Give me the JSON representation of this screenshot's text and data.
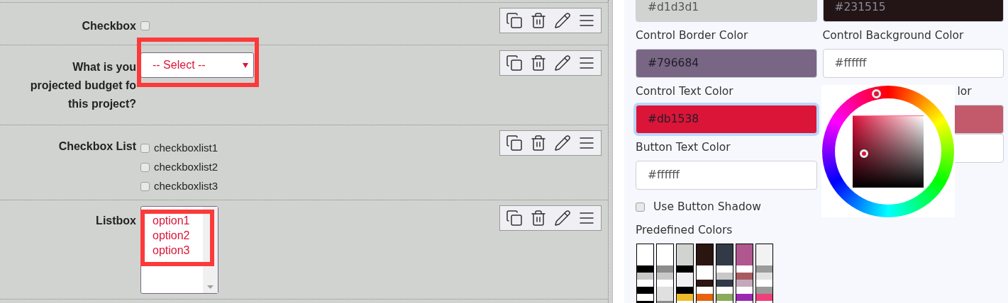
{
  "form_rows": [
    {
      "kind": "checkbox",
      "label": "Checkbox",
      "checked": false
    },
    {
      "kind": "select",
      "label": "What is you\nprojected budget fo\nthis project?",
      "value": "-- Select --"
    },
    {
      "kind": "checkbox_list",
      "label": "Checkbox List",
      "items": [
        {
          "label": "checkboxlist1",
          "checked": false
        },
        {
          "label": "checkboxlist2",
          "checked": false
        },
        {
          "label": "checkboxlist3",
          "checked": false
        }
      ]
    },
    {
      "kind": "listbox",
      "label": "Listbox",
      "options": [
        "option1",
        "option2",
        "option3"
      ]
    }
  ],
  "color_fields": [
    {
      "value": "#d1d3d1",
      "color": "#d1d3d1",
      "focused": false
    },
    {
      "value": "#231515",
      "color": "#231515",
      "focused": false
    },
    {
      "label": "Control Border Color",
      "value": "#796684",
      "color": "#796684",
      "focused": false
    },
    {
      "label": "Control Background Color",
      "value": "#ffffff",
      "color": "#ffffff",
      "focused": false
    },
    {
      "label": "Control Text Color",
      "value": "#db1538",
      "color": "#db1538",
      "focused": true
    },
    {
      "label": "lor",
      "color": "#c25a6b",
      "focused": false
    },
    {
      "label": "Button Text Color",
      "value": "#ffffff",
      "color": "#ffffff",
      "focused": false
    },
    {
      "color": "#ffffff",
      "focused": false
    }
  ],
  "button_shadow": {
    "label": "Use Button Shadow",
    "checked": false
  },
  "predefined": {
    "label": "Predefined Colors",
    "swatches": [
      {
        "bands": [
          {
            "color": "#ffffff"
          },
          {
            "color": "#000000"
          },
          {
            "color": "#c8c8c8"
          },
          {
            "color": "#ffffff"
          },
          {
            "color": "#000000"
          },
          {
            "color": "#ffffff"
          },
          {
            "color": "#000000"
          }
        ]
      },
      {
        "bands": [
          {
            "color": "#ffffff"
          },
          {
            "color": "#8c8c8c"
          },
          {
            "color": "#c8c8c8"
          },
          {
            "color": "#ffffff"
          },
          {
            "color": "#e0e0e0"
          },
          {
            "color": "#e0e0e0"
          },
          {
            "color": "#8c8c8c"
          }
        ]
      },
      {
        "bands": [
          {
            "color": "#d1d3d1"
          },
          {
            "color": "#000000"
          },
          {
            "color": "#f0f0f2"
          },
          {
            "color": "#f0f0f2"
          },
          {
            "color": "#000000"
          },
          {
            "color": "#f0bc2a"
          },
          {
            "color": "#ffffff"
          }
        ]
      },
      {
        "bands": [
          {
            "color": "#2a1510"
          },
          {
            "color": "#ffffff"
          },
          {
            "color": "#ffffff"
          },
          {
            "color": "#2a1510"
          },
          {
            "color": "#ffffff"
          },
          {
            "color": "#e8620e"
          },
          {
            "color": "#ffffff"
          }
        ]
      },
      {
        "bands": [
          {
            "color": "#323a48"
          },
          {
            "color": "#ffffff"
          },
          {
            "color": "#c8c8c8"
          },
          {
            "color": "#323a48"
          },
          {
            "color": "#ffffff"
          },
          {
            "color": "#8aab5a"
          },
          {
            "color": "#ffffff"
          }
        ]
      },
      {
        "bands": [
          {
            "color": "#b0578f"
          },
          {
            "color": "#ffffff"
          },
          {
            "color": "#a85b5e"
          },
          {
            "color": "#c4a8bc"
          },
          {
            "color": "#ffffff"
          },
          {
            "color": "#9b2ab0"
          },
          {
            "color": "#ffffff"
          }
        ]
      },
      {
        "bands": [
          {
            "color": "#f2f2f2"
          },
          {
            "color": "#9b9b9b"
          },
          {
            "color": "#e2e2e2"
          },
          {
            "color": "#ffffff"
          },
          {
            "color": "#9b9b9b"
          },
          {
            "color": "#ec417a"
          },
          {
            "color": "#ffffff"
          }
        ]
      }
    ]
  }
}
